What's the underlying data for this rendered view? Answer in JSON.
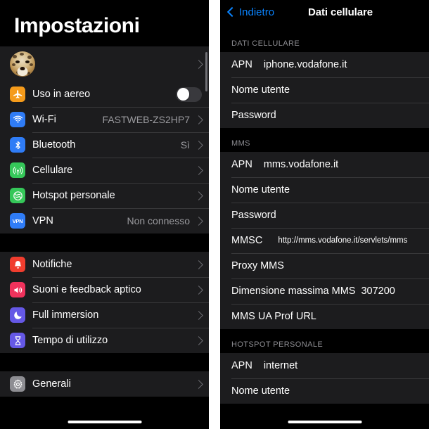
{
  "left_panel": {
    "title": "Impostazioni",
    "account": {
      "avatar_icon": "cheetah-avatar-photo",
      "chevron_icon": "chevron-right-icon"
    },
    "groups": [
      {
        "name": "connectivity",
        "rows": [
          {
            "icon": "airplane-icon",
            "icon_color": "#f59b1b",
            "label": "Uso in aereo",
            "value": "",
            "control": "toggle",
            "toggle_on": false
          },
          {
            "icon": "wifi-icon",
            "icon_color": "#2f7cf6",
            "label": "Wi-Fi",
            "value": "FASTWEB-ZS2HP7",
            "control": "chevron"
          },
          {
            "icon": "bluetooth-icon",
            "icon_color": "#2f7cf6",
            "label": "Bluetooth",
            "value": "Sì",
            "control": "chevron"
          },
          {
            "icon": "cellular-icon",
            "icon_color": "#35c759",
            "label": "Cellulare",
            "value": "",
            "control": "chevron"
          },
          {
            "icon": "hotspot-icon",
            "icon_color": "#35c759",
            "label": "Hotspot personale",
            "value": "",
            "control": "chevron"
          },
          {
            "icon": "vpn-icon",
            "icon_color": "#2f7cf6",
            "label": "VPN",
            "value": "Non connesso",
            "control": "chevron"
          }
        ]
      },
      {
        "name": "notifications",
        "rows": [
          {
            "icon": "bell-icon",
            "icon_color": "#f03d2e",
            "label": "Notifiche",
            "value": "",
            "control": "chevron"
          },
          {
            "icon": "speaker-icon",
            "icon_color": "#f0325c",
            "label": "Suoni e feedback aptico",
            "value": "",
            "control": "chevron"
          },
          {
            "icon": "moon-icon",
            "icon_color": "#6558e6",
            "label": "Full immersion",
            "value": "",
            "control": "chevron"
          },
          {
            "icon": "hourglass-icon",
            "icon_color": "#6558e6",
            "label": "Tempo di utilizzo",
            "value": "",
            "control": "chevron"
          }
        ]
      },
      {
        "name": "system",
        "rows": [
          {
            "icon": "gear-icon",
            "icon_color": "#8e8e93",
            "label": "Generali",
            "value": "",
            "control": "chevron"
          }
        ]
      }
    ]
  },
  "right_panel": {
    "nav": {
      "back_label": "Indietro",
      "back_icon": "chevron-left-icon",
      "title": "Dati cellulare"
    },
    "sections": [
      {
        "header": "DATI CELLULARE",
        "rows": [
          {
            "key": "APN",
            "value": "iphone.vodafone.it",
            "value_style": "normal"
          },
          {
            "key": "Nome utente",
            "value": "",
            "value_style": "normal"
          },
          {
            "key": "Password",
            "value": "",
            "value_style": "normal"
          }
        ]
      },
      {
        "header": "MMS",
        "rows": [
          {
            "key": "APN",
            "value": "mms.vodafone.it",
            "value_style": "normal"
          },
          {
            "key": "Nome utente",
            "value": "",
            "value_style": "normal"
          },
          {
            "key": "Password",
            "value": "",
            "value_style": "normal"
          },
          {
            "key": "MMSC",
            "value": "http://mms.vodafone.it/servlets/mms",
            "value_style": "small"
          },
          {
            "key": "Proxy MMS",
            "value": "",
            "value_style": "normal"
          },
          {
            "key": "Dimensione massima MMS",
            "value": "307200",
            "value_style": "tight"
          },
          {
            "key": "MMS UA Prof URL",
            "value": "",
            "value_style": "normal"
          }
        ]
      },
      {
        "header": "HOTSPOT PERSONALE",
        "rows": [
          {
            "key": "APN",
            "value": "internet",
            "value_style": "normal"
          },
          {
            "key": "Nome utente",
            "value": "",
            "value_style": "normal"
          }
        ]
      }
    ]
  }
}
